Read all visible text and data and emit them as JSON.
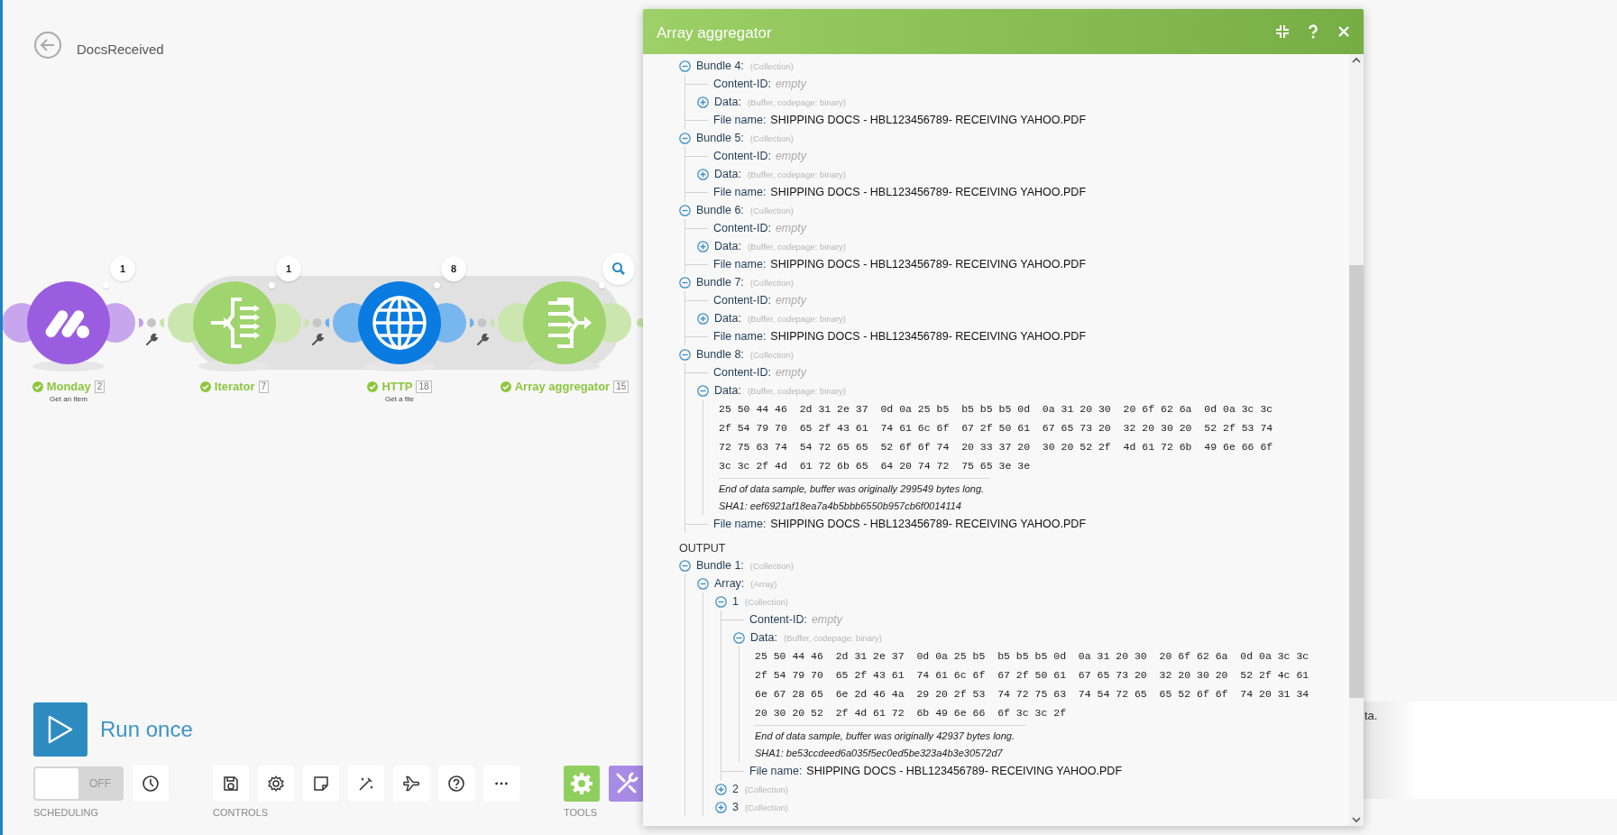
{
  "scenario": {
    "name": "DocsReceived"
  },
  "modules": [
    {
      "kind": "monday",
      "name": "Monday",
      "badge": "2",
      "subtitle": "Get an Item",
      "color": "#9b5de0",
      "done": true,
      "bubble": {
        "kind": "count",
        "text": "1"
      }
    },
    {
      "kind": "iterator",
      "name": "Iterator",
      "badge": "7",
      "color": "#a0d46e",
      "done": true,
      "bubble": {
        "kind": "count",
        "text": "1"
      }
    },
    {
      "kind": "http",
      "name": "HTTP",
      "badge": "18",
      "subtitle": "Get a file",
      "color": "#0a7be0",
      "done": true,
      "bubble": {
        "kind": "count",
        "text": "8"
      }
    },
    {
      "kind": "aggregator",
      "name": "Array aggregator",
      "badge": "15",
      "color": "#a0d46e",
      "done": true,
      "bubble": {
        "kind": "search"
      }
    }
  ],
  "panel": {
    "title": "Array aggregator",
    "tree": [
      {
        "kind": "node",
        "label": "Bundle 4:",
        "type": "(Collection)",
        "expanded": true,
        "children": [
          {
            "kind": "blank",
            "label": "Content-ID:",
            "hint": "empty"
          },
          {
            "kind": "node",
            "label": "Data:",
            "type": "(Buffer, codepage: binary)",
            "expanded": false
          },
          {
            "kind": "field",
            "label": "File name:",
            "value": "SHIPPING DOCS - HBL123456789- RECEIVING YAHOO.PDF"
          }
        ]
      },
      {
        "kind": "node",
        "label": "Bundle 5:",
        "type": "(Collection)",
        "expanded": true,
        "children": [
          {
            "kind": "blank",
            "label": "Content-ID:",
            "hint": "empty"
          },
          {
            "kind": "node",
            "label": "Data:",
            "type": "(Buffer, codepage: binary)",
            "expanded": false
          },
          {
            "kind": "field",
            "label": "File name:",
            "value": "SHIPPING DOCS - HBL123456789- RECEIVING YAHOO.PDF"
          }
        ]
      },
      {
        "kind": "node",
        "label": "Bundle 6:",
        "type": "(Collection)",
        "expanded": true,
        "children": [
          {
            "kind": "blank",
            "label": "Content-ID:",
            "hint": "empty"
          },
          {
            "kind": "node",
            "label": "Data:",
            "type": "(Buffer, codepage: binary)",
            "expanded": false
          },
          {
            "kind": "field",
            "label": "File name:",
            "value": "SHIPPING DOCS - HBL123456789- RECEIVING YAHOO.PDF"
          }
        ]
      },
      {
        "kind": "node",
        "label": "Bundle 7:",
        "type": "(Collection)",
        "expanded": true,
        "children": [
          {
            "kind": "blank",
            "label": "Content-ID:",
            "hint": "empty"
          },
          {
            "kind": "node",
            "label": "Data:",
            "type": "(Buffer, codepage: binary)",
            "expanded": false
          },
          {
            "kind": "field",
            "label": "File name:",
            "value": "SHIPPING DOCS - HBL123456789- RECEIVING YAHOO.PDF"
          }
        ]
      },
      {
        "kind": "node",
        "label": "Bundle 8:",
        "type": "(Collection)",
        "expanded": true,
        "children": [
          {
            "kind": "blank",
            "label": "Content-ID:",
            "hint": "empty"
          },
          {
            "kind": "node",
            "label": "Data:",
            "type": "(Buffer, codepage: binary)",
            "expanded": true,
            "children": [
              {
                "kind": "hex",
                "lines": [
                  "25 50 44 46  2d 31 2e 37  0d 0a 25 b5  b5 b5 b5 0d  0a 31 20 30  20 6f 62 6a  0d 0a 3c 3c",
                  "2f 54 79 70  65 2f 43 61  74 61 6c 6f  67 2f 50 61  67 65 73 20  32 20 30 20  52 2f 53 74",
                  "72 75 63 74  54 72 65 65  52 6f 6f 74  20 33 37 20  30 20 52 2f  4d 61 72 6b  49 6e 66 6f",
                  "3c 3c 2f 4d  61 72 6b 65  64 20 74 72  75 65 3e 3e"
                ],
                "notes": [
                  "End of data sample, buffer was originally 299549 bytes long.",
                  "SHA1: eef6921af18ea7a4b5bbb6550b957cb6f0014114"
                ]
              }
            ]
          },
          {
            "kind": "field",
            "label": "File name:",
            "value": "SHIPPING DOCS - HBL123456789- RECEIVING YAHOO.PDF"
          }
        ]
      },
      {
        "kind": "heading",
        "label": "OUTPUT"
      },
      {
        "kind": "node",
        "label": "Bundle 1:",
        "type": "(Collection)",
        "expanded": true,
        "children": [
          {
            "kind": "node",
            "label": "Array:",
            "type": "(Array)",
            "expanded": true,
            "children": [
              {
                "kind": "node",
                "label": "1",
                "type": "(Collection)",
                "expanded": true,
                "children": [
                  {
                    "kind": "blank",
                    "label": "Content-ID:",
                    "hint": "empty"
                  },
                  {
                    "kind": "node",
                    "label": "Data:",
                    "type": "(Buffer, codepage: binary)",
                    "expanded": true,
                    "children": [
                      {
                        "kind": "hex",
                        "lines": [
                          "25 50 44 46  2d 31 2e 37  0d 0a 25 b5  b5 b5 b5 0d  0a 31 20 30  20 6f 62 6a  0d 0a 3c 3c",
                          "2f 54 79 70  65 2f 43 61  74 61 6c 6f  67 2f 50 61  67 65 73 20  32 20 30 20  52 2f 4c 61",
                          "6e 67 28 65  6e 2d 46 4a  29 20 2f 53  74 72 75 63  74 54 72 65  65 52 6f 6f  74 20 31 34",
                          "20 30 20 52  2f 4d 61 72  6b 49 6e 66  6f 3c 3c 2f"
                        ],
                        "notes": [
                          "End of data sample, buffer was originally 42937 bytes long.",
                          "SHA1: be53ccdeed6a035f5ec0ed5be323a4b3e30572d7"
                        ]
                      }
                    ]
                  },
                  {
                    "kind": "field",
                    "label": "File name:",
                    "value": "SHIPPING DOCS - HBL123456789- RECEIVING YAHOO.PDF"
                  }
                ]
              },
              {
                "kind": "node",
                "label": "2",
                "type": "(Collection)",
                "expanded": false
              },
              {
                "kind": "node",
                "label": "3",
                "type": "(Collection)",
                "expanded": false
              }
            ]
          }
        ]
      }
    ]
  },
  "toolbar": {
    "run": {
      "label": "Run once"
    },
    "scheduling": {
      "label": "SCHEDULING",
      "toggle": {
        "on": false,
        "text": "OFF"
      },
      "buttons": [
        {
          "kind": "clock"
        }
      ]
    },
    "controls": {
      "label": "CONTROLS",
      "buttons": [
        {
          "kind": "save"
        },
        {
          "kind": "settings"
        },
        {
          "kind": "note"
        },
        {
          "kind": "magic"
        },
        {
          "kind": "plane"
        },
        {
          "kind": "help"
        },
        {
          "kind": "more"
        }
      ]
    },
    "tools": {
      "label": "TOOLS",
      "buttons": [
        {
          "kind": "gear",
          "color": "#8fcf5f"
        },
        {
          "kind": "tools",
          "color": "#a98be6"
        }
      ]
    }
  },
  "notice": {
    "text": "ta."
  }
}
